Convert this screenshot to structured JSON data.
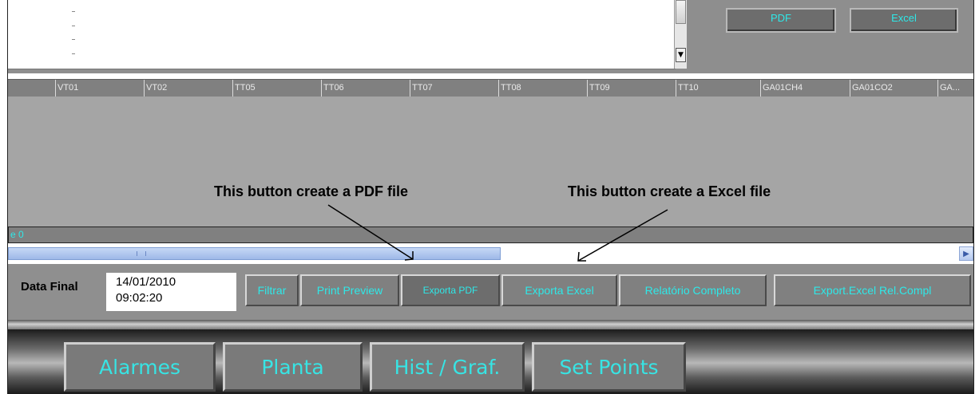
{
  "top": {
    "pdf_button": "PDF",
    "excel_button": "Excel"
  },
  "table": {
    "columns": [
      "VT01",
      "VT02",
      "TT05",
      "TT06",
      "TT07",
      "TT08",
      "TT09",
      "TT10",
      "GA01CH4",
      "GA01CO2",
      "GA..."
    ],
    "row_text": "e 0"
  },
  "annotations": {
    "pdf_note": "This button create a PDF file",
    "excel_note": "This button create a Excel file"
  },
  "filter": {
    "label": "Data Final",
    "date": "14/01/2010",
    "time": "09:02:20"
  },
  "toolbar": {
    "filtrar": "Filtrar",
    "print_preview": "Print Preview",
    "exporta_pdf": "Exporta PDF",
    "exporta_excel": "Exporta Excel",
    "relatorio_completo": "Relatório Completo",
    "export_excel_rel": "Export.Excel Rel.Compl"
  },
  "nav": {
    "alarmes": "Alarmes",
    "planta": "Planta",
    "hist_graf": "Hist / Graf.",
    "set_points": "Set Points"
  },
  "colors": {
    "accent_text": "#2ee8e8",
    "panel": "#8f8f8f",
    "scroll_thumb": "#9eb8e8"
  }
}
